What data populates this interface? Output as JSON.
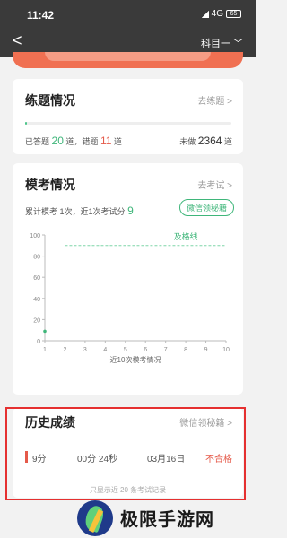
{
  "status_bar": {
    "time": "11:42",
    "network": "4G",
    "battery": "65"
  },
  "nav": {
    "back_glyph": "<",
    "subject": "科目一",
    "dropdown_glyph": "﹀"
  },
  "practice": {
    "title": "练题情况",
    "link": "去练题 >",
    "answered_prefix": "已答题",
    "answered_count": "20",
    "answered_unit": "道，错题",
    "wrong_count": "11",
    "wrong_unit": "道",
    "undone_prefix": "未做",
    "undone_count": "2364",
    "undone_unit": "道",
    "progress": 0.008
  },
  "mock": {
    "title": "模考情况",
    "link": "去考试 >",
    "sub_prefix": "累计模考",
    "sub_count": "1次，近1次考试分",
    "last_score": "9",
    "wechat_button": "微信领秘籍",
    "chart_data": {
      "type": "line",
      "x": [
        1
      ],
      "y": [
        9
      ],
      "xlim": [
        1,
        10
      ],
      "ylim": [
        0,
        100
      ],
      "xticks": [
        "1",
        "2",
        "3",
        "4",
        "5",
        "6",
        "7",
        "8",
        "9",
        "10"
      ],
      "yticks": [
        "0",
        "20",
        "40",
        "60",
        "80",
        "100"
      ],
      "pass_line": 90,
      "pass_label": "及格线",
      "xlabel": "近10次模考情况",
      "colors": {
        "line": "#3fb67a",
        "pass": "#7fd6a8"
      }
    }
  },
  "history": {
    "title": "历史成绩",
    "link": "微信领秘籍 >",
    "rows": [
      {
        "score": "9分",
        "duration": "00分 24秒",
        "date": "03月16日",
        "result": "不合格"
      }
    ],
    "note": "只显示近 20 条考试记录"
  },
  "watermark": {
    "text": "极限手游网"
  }
}
